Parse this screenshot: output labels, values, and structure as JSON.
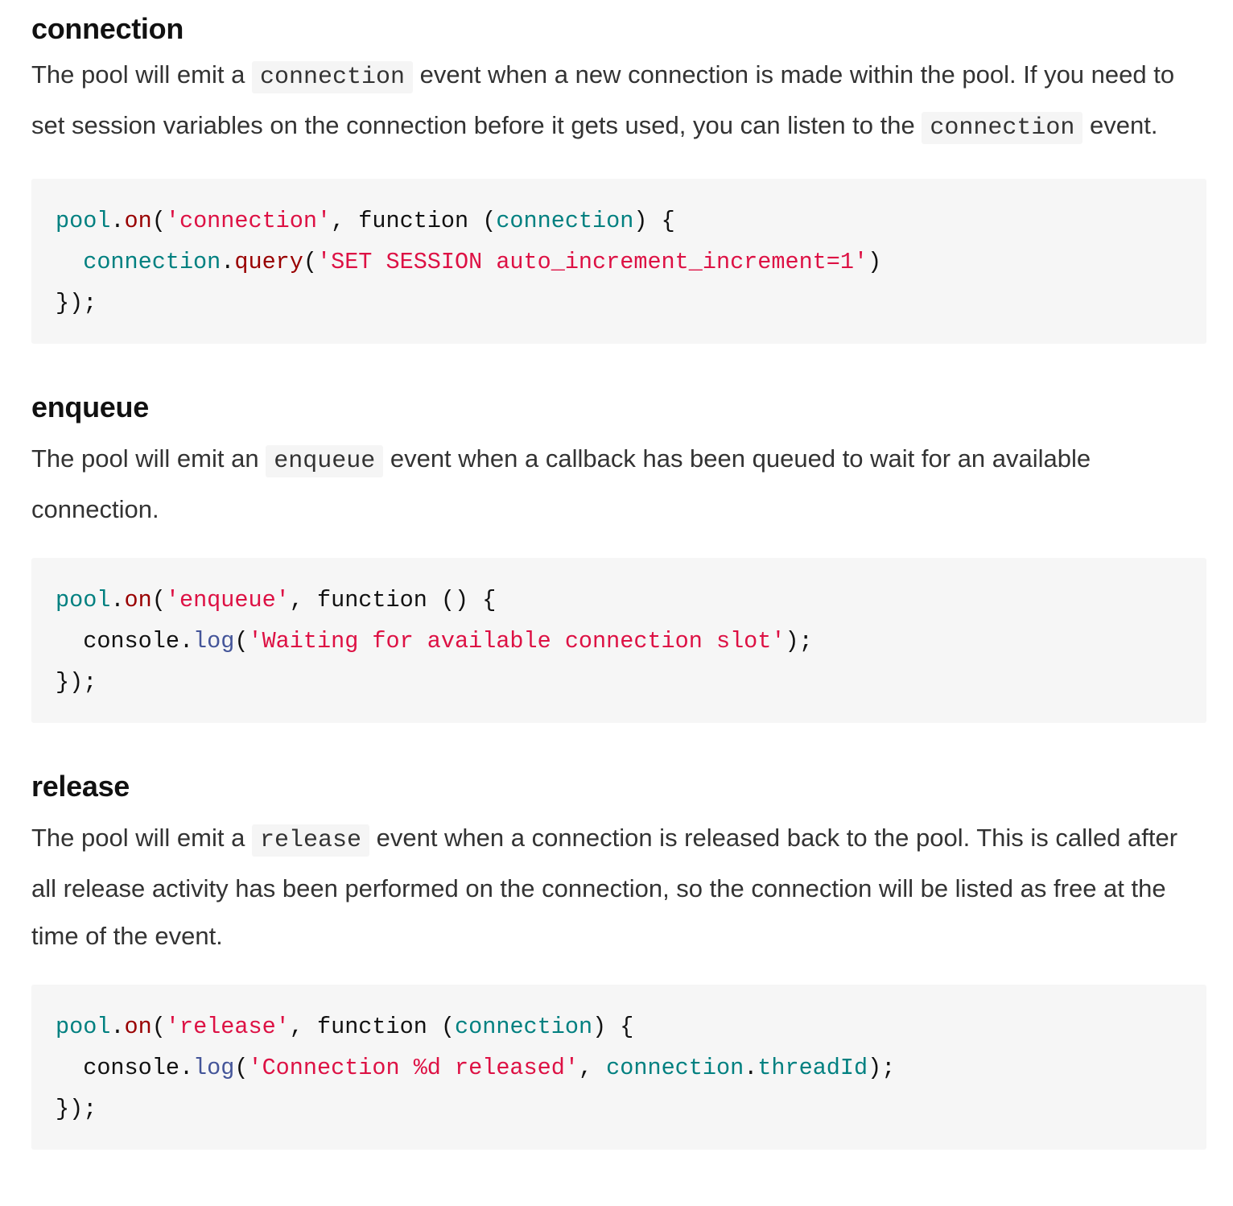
{
  "sections": {
    "connection": {
      "heading": "connection",
      "text_1": "The pool will emit a ",
      "code_1": "connection",
      "text_2": " event when a new connection is made within the pool. If you need to set session variables on the connection before it gets used, you can listen to the ",
      "code_2": "connection",
      "text_3": " event.",
      "snippet": {
        "l1_obj": "pool",
        "l1_dot": ".",
        "l1_method": "on",
        "l1_open": "(",
        "l1_str": "'connection'",
        "l1_mid": ", function (",
        "l1_param": "connection",
        "l1_close": ") {",
        "l2_indent": "  ",
        "l2_obj": "connection",
        "l2_dot": ".",
        "l2_method": "query",
        "l2_open": "(",
        "l2_str": "'SET SESSION auto_increment_increment=1'",
        "l2_close": ")",
        "l3": "});"
      }
    },
    "enqueue": {
      "heading": "enqueue",
      "text_1": "The pool will emit an ",
      "code_1": "enqueue",
      "text_2": " event when a callback has been queued to wait for an available connection.",
      "snippet": {
        "l1_obj": "pool",
        "l1_dot": ".",
        "l1_method": "on",
        "l1_open": "(",
        "l1_str": "'enqueue'",
        "l1_mid": ", function () {",
        "l2_indent": "  ",
        "l2_obj": "console.",
        "l2_fn": "log",
        "l2_open": "(",
        "l2_str": "'Waiting for available connection slot'",
        "l2_close": ");",
        "l3": "});"
      }
    },
    "release": {
      "heading": "release",
      "text_1": "The pool will emit a ",
      "code_1": "release",
      "text_2": " event when a connection is released back to the pool. This is called after all release activity has been performed on the connection, so the connection will be listed as free at the time of the event.",
      "snippet": {
        "l1_obj": "pool",
        "l1_dot": ".",
        "l1_method": "on",
        "l1_open": "(",
        "l1_str": "'release'",
        "l1_mid": ", function (",
        "l1_param": "connection",
        "l1_close": ") {",
        "l2_indent": "  ",
        "l2_obj": "console.",
        "l2_fn": "log",
        "l2_open": "(",
        "l2_str": "'Connection %d released'",
        "l2_comma": ", ",
        "l2_arg_obj": "connection",
        "l2_arg_dot": ".",
        "l2_arg_prop": "threadId",
        "l2_close": ");",
        "l3": "});"
      }
    }
  },
  "colors": {
    "object": "#008080",
    "method": "#990000",
    "string": "#dd1144",
    "function": "#445599",
    "code_bg": "#f6f6f6"
  }
}
